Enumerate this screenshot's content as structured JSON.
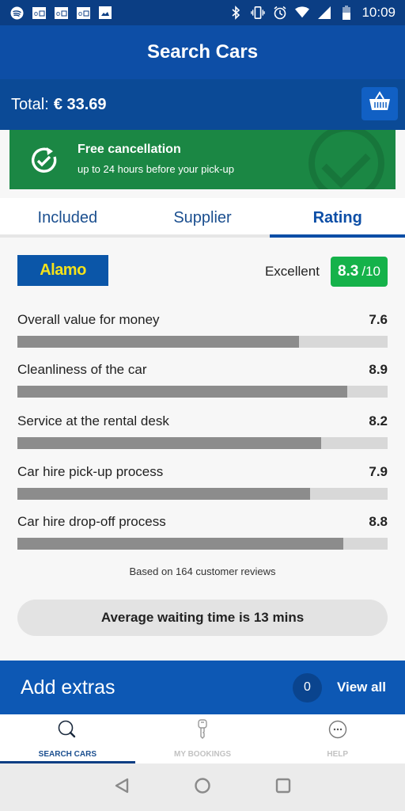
{
  "status_bar": {
    "time": "10:09",
    "left_icons": [
      "spotify-icon",
      "outlook-icon",
      "outlook-icon",
      "outlook-icon",
      "image-icon"
    ],
    "right_icons": [
      "bluetooth-icon",
      "vibrate-icon",
      "alarm-icon",
      "wifi-icon",
      "signal-icon",
      "battery-icon"
    ]
  },
  "app_bar": {
    "title": "Search Cars"
  },
  "total_bar": {
    "label": "Total:",
    "amount": "€ 33.69",
    "basket_icon": "basket-icon"
  },
  "free_cancellation": {
    "title": "Free cancellation",
    "subtitle": "up to 24 hours before your pick-up"
  },
  "tabs": [
    {
      "label": "Included",
      "active": false
    },
    {
      "label": "Supplier",
      "active": false
    },
    {
      "label": "Rating",
      "active": true
    }
  ],
  "rating": {
    "supplier_logo": "Alamo",
    "overall_label": "Excellent",
    "overall_score": "8.3",
    "overall_max": "/10",
    "criteria": [
      {
        "label": "Overall value for money",
        "value": "7.6",
        "fraction": 0.76
      },
      {
        "label": "Cleanliness of the car",
        "value": "8.9",
        "fraction": 0.89
      },
      {
        "label": "Service at the rental desk",
        "value": "8.2",
        "fraction": 0.82
      },
      {
        "label": "Car hire pick-up process",
        "value": "7.9",
        "fraction": 0.79
      },
      {
        "label": "Car hire drop-off process",
        "value": "8.8",
        "fraction": 0.88
      }
    ],
    "based_on": "Based on 164 customer reviews",
    "waiting_time": "Average waiting time is 13 mins"
  },
  "extras": {
    "title": "Add extras",
    "count": "0",
    "view_all": "View all"
  },
  "bottom_nav": [
    {
      "label": "SEARCH CARS",
      "icon": "search-icon",
      "active": true
    },
    {
      "label": "MY BOOKINGS",
      "icon": "key-icon",
      "active": false
    },
    {
      "label": "HELP",
      "icon": "more-icon",
      "active": false
    }
  ],
  "colors": {
    "primary": "#0d4ea6",
    "success": "#1b8744",
    "score_badge": "#15b24a"
  }
}
